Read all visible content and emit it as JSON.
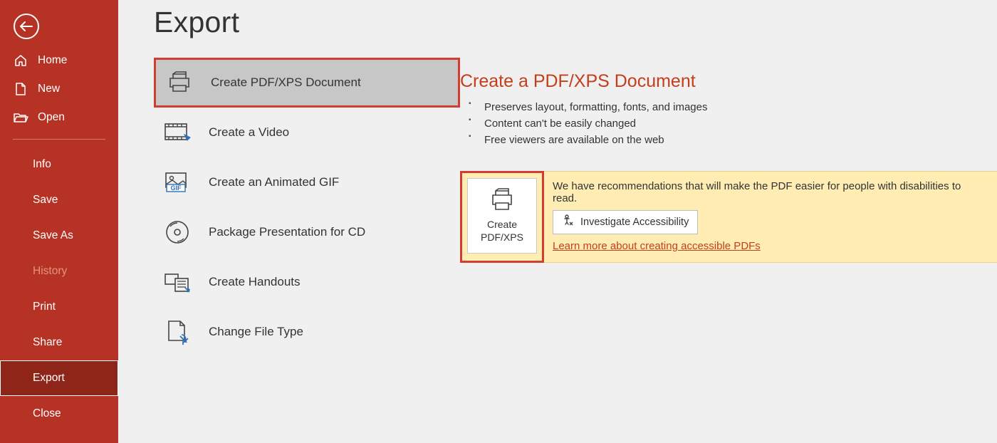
{
  "sidebar": {
    "items": [
      {
        "label": "Home"
      },
      {
        "label": "New"
      },
      {
        "label": "Open"
      },
      {
        "label": "Info"
      },
      {
        "label": "Save"
      },
      {
        "label": "Save As"
      },
      {
        "label": "History"
      },
      {
        "label": "Print"
      },
      {
        "label": "Share"
      },
      {
        "label": "Export"
      },
      {
        "label": "Close"
      }
    ]
  },
  "page": {
    "title": "Export"
  },
  "exportOptions": [
    {
      "label": "Create PDF/XPS Document"
    },
    {
      "label": "Create a Video"
    },
    {
      "label": "Create an Animated GIF"
    },
    {
      "label": "Package Presentation for CD"
    },
    {
      "label": "Create Handouts"
    },
    {
      "label": "Change File Type"
    }
  ],
  "detail": {
    "title": "Create a PDF/XPS Document",
    "bullets": [
      "Preserves layout, formatting, fonts, and images",
      "Content can't be easily changed",
      "Free viewers are available on the web"
    ],
    "createBtn": {
      "line1": "Create",
      "line2": "PDF/XPS"
    },
    "banner": {
      "text": "We have recommendations that will make the PDF easier for people with disabilities to read.",
      "investigate": "Investigate Accessibility",
      "learn": "Learn more about creating accessible PDFs"
    }
  }
}
